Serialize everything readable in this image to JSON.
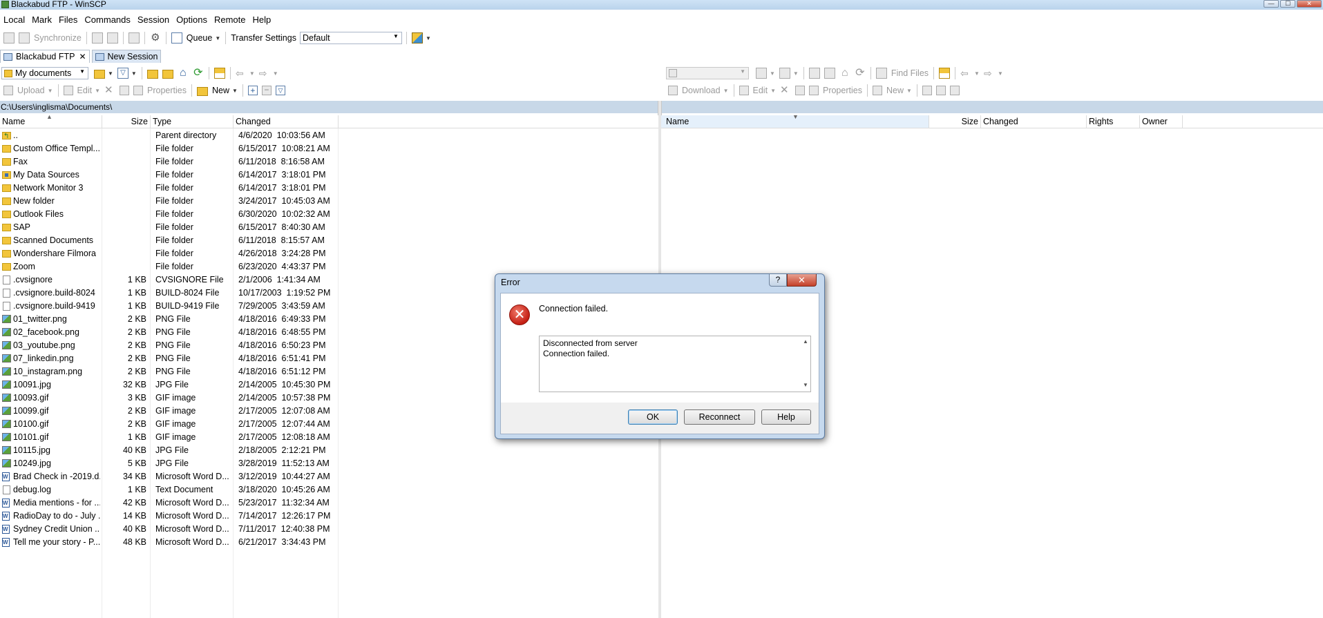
{
  "window": {
    "title": "Blackabud FTP - WinSCP",
    "min": "—",
    "max": "☐",
    "close": "✕"
  },
  "menu": [
    "Local",
    "Mark",
    "Files",
    "Commands",
    "Session",
    "Options",
    "Remote",
    "Help"
  ],
  "toolbar": {
    "synchronize": "Synchronize",
    "queue": "Queue",
    "transfer_settings_label": "Transfer Settings",
    "transfer_settings_value": "Default"
  },
  "tabs": [
    {
      "label": "Blackabud FTP",
      "close": "✕"
    },
    {
      "label": "New Session"
    }
  ],
  "local": {
    "location": "My documents",
    "upload": "Upload",
    "edit": "Edit",
    "properties": "Properties",
    "new": "New",
    "path": "C:\\Users\\inglisma\\Documents\\",
    "columns": {
      "name": "Name",
      "size": "Size",
      "type": "Type",
      "changed": "Changed"
    },
    "files": [
      {
        "icon": "parent",
        "name": "..",
        "size": "",
        "type": "Parent directory",
        "changed": "4/6/2020  10:03:56 AM"
      },
      {
        "icon": "folder",
        "name": "Custom Office Templ...",
        "size": "",
        "type": "File folder",
        "changed": "6/15/2017  10:08:21 AM"
      },
      {
        "icon": "folder",
        "name": "Fax",
        "size": "",
        "type": "File folder",
        "changed": "6/11/2018  8:16:58 AM"
      },
      {
        "icon": "special",
        "name": "My Data Sources",
        "size": "",
        "type": "File folder",
        "changed": "6/14/2017  3:18:01 PM"
      },
      {
        "icon": "folder",
        "name": "Network Monitor 3",
        "size": "",
        "type": "File folder",
        "changed": "6/14/2017  3:18:01 PM"
      },
      {
        "icon": "folder",
        "name": "New folder",
        "size": "",
        "type": "File folder",
        "changed": "3/24/2017  10:45:03 AM"
      },
      {
        "icon": "folder",
        "name": "Outlook Files",
        "size": "",
        "type": "File folder",
        "changed": "6/30/2020  10:02:32 AM"
      },
      {
        "icon": "folder",
        "name": "SAP",
        "size": "",
        "type": "File folder",
        "changed": "6/15/2017  8:40:30 AM"
      },
      {
        "icon": "folder",
        "name": "Scanned Documents",
        "size": "",
        "type": "File folder",
        "changed": "6/11/2018  8:15:57 AM"
      },
      {
        "icon": "folder",
        "name": "Wondershare Filmora",
        "size": "",
        "type": "File folder",
        "changed": "4/26/2018  3:24:28 PM"
      },
      {
        "icon": "folder",
        "name": "Zoom",
        "size": "",
        "type": "File folder",
        "changed": "6/23/2020  4:43:37 PM"
      },
      {
        "icon": "file",
        "name": ".cvsignore",
        "size": "1 KB",
        "type": "CVSIGNORE File",
        "changed": "2/1/2006  1:41:34 AM"
      },
      {
        "icon": "file",
        "name": ".cvsignore.build-8024",
        "size": "1 KB",
        "type": "BUILD-8024 File",
        "changed": "10/17/2003  1:19:52 PM"
      },
      {
        "icon": "file",
        "name": ".cvsignore.build-9419",
        "size": "1 KB",
        "type": "BUILD-9419 File",
        "changed": "7/29/2005  3:43:59 AM"
      },
      {
        "icon": "image",
        "name": "01_twitter.png",
        "size": "2 KB",
        "type": "PNG File",
        "changed": "4/18/2016  6:49:33 PM"
      },
      {
        "icon": "image",
        "name": "02_facebook.png",
        "size": "2 KB",
        "type": "PNG File",
        "changed": "4/18/2016  6:48:55 PM"
      },
      {
        "icon": "image",
        "name": "03_youtube.png",
        "size": "2 KB",
        "type": "PNG File",
        "changed": "4/18/2016  6:50:23 PM"
      },
      {
        "icon": "image",
        "name": "07_linkedin.png",
        "size": "2 KB",
        "type": "PNG File",
        "changed": "4/18/2016  6:51:41 PM"
      },
      {
        "icon": "image",
        "name": "10_instagram.png",
        "size": "2 KB",
        "type": "PNG File",
        "changed": "4/18/2016  6:51:12 PM"
      },
      {
        "icon": "image",
        "name": "10091.jpg",
        "size": "32 KB",
        "type": "JPG File",
        "changed": "2/14/2005  10:45:30 PM"
      },
      {
        "icon": "image",
        "name": "10093.gif",
        "size": "3 KB",
        "type": "GIF image",
        "changed": "2/14/2005  10:57:38 PM"
      },
      {
        "icon": "image",
        "name": "10099.gif",
        "size": "2 KB",
        "type": "GIF image",
        "changed": "2/17/2005  12:07:08 AM"
      },
      {
        "icon": "image",
        "name": "10100.gif",
        "size": "2 KB",
        "type": "GIF image",
        "changed": "2/17/2005  12:07:44 AM"
      },
      {
        "icon": "image",
        "name": "10101.gif",
        "size": "1 KB",
        "type": "GIF image",
        "changed": "2/17/2005  12:08:18 AM"
      },
      {
        "icon": "image",
        "name": "10115.jpg",
        "size": "40 KB",
        "type": "JPG File",
        "changed": "2/18/2005  2:12:21 PM"
      },
      {
        "icon": "image",
        "name": "10249.jpg",
        "size": "5 KB",
        "type": "JPG File",
        "changed": "3/28/2019  11:52:13 AM"
      },
      {
        "icon": "word",
        "name": "Brad Check in -2019.d...",
        "size": "34 KB",
        "type": "Microsoft Word D...",
        "changed": "3/12/2019  10:44:27 AM"
      },
      {
        "icon": "file",
        "name": "debug.log",
        "size": "1 KB",
        "type": "Text Document",
        "changed": "3/18/2020  10:45:26 AM"
      },
      {
        "icon": "word",
        "name": "Media mentions - for ...",
        "size": "42 KB",
        "type": "Microsoft Word D...",
        "changed": "5/23/2017  11:32:34 AM"
      },
      {
        "icon": "word",
        "name": "RadioDay to do - July ...",
        "size": "14 KB",
        "type": "Microsoft Word D...",
        "changed": "7/14/2017  12:26:17 PM"
      },
      {
        "icon": "word",
        "name": "Sydney Credit Union ...",
        "size": "40 KB",
        "type": "Microsoft Word D...",
        "changed": "7/11/2017  12:40:38 PM"
      },
      {
        "icon": "word",
        "name": "Tell me your story - P...",
        "size": "48 KB",
        "type": "Microsoft Word D...",
        "changed": "6/21/2017  3:34:43 PM"
      }
    ]
  },
  "remote": {
    "find_files": "Find Files",
    "download": "Download",
    "edit": "Edit",
    "properties": "Properties",
    "new": "New",
    "columns": {
      "name": "Name",
      "size": "Size",
      "changed": "Changed",
      "rights": "Rights",
      "owner": "Owner"
    }
  },
  "dialog": {
    "title": "Error",
    "help_glyph": "?",
    "close_glyph": "✕",
    "error_glyph": "✕",
    "message": "Connection failed.",
    "details": [
      "Disconnected from server",
      "Connection failed."
    ],
    "buttons": {
      "ok": "OK",
      "reconnect": "Reconnect",
      "help": "Help"
    }
  },
  "colors": {
    "path_bar": "#c8d8e8",
    "dialog_frame": "#c6d9ee",
    "error_red": "#c41f14",
    "folder": "#f2c53b"
  }
}
